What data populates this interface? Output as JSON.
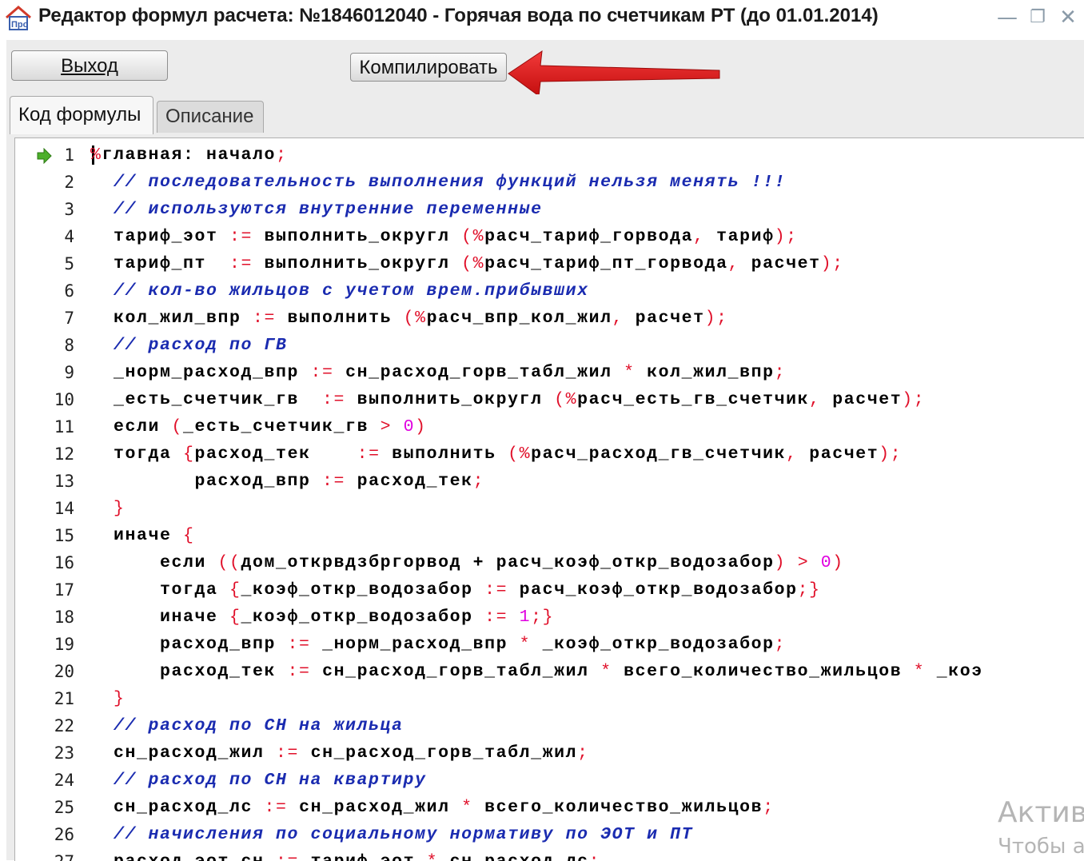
{
  "window": {
    "title": "Редактор формул расчета:  №1846012040 - Горячая вода по счетчикам РТ (до 01.01.2014)",
    "app_icon": "pro-logo-house-icon",
    "controls": [
      "minimize-icon",
      "maximize-icon",
      "close-icon"
    ]
  },
  "toolbar": {
    "exit_label": "Выход",
    "compile_label": "Компилировать",
    "annotation": "red-arrow-pointing-at-compile"
  },
  "tabs": [
    {
      "label": "Код формулы",
      "active": true
    },
    {
      "label": "Описание",
      "active": false
    }
  ],
  "editor": {
    "current_line": 1,
    "line_numbers": [
      "1",
      "2",
      "3",
      "4",
      "5",
      "6",
      "7",
      "8",
      "9",
      "10",
      "11",
      "12",
      "13",
      "14",
      "15",
      "16",
      "17",
      "18",
      "19",
      "20",
      "21",
      "22",
      "23",
      "24",
      "25",
      "26",
      "27"
    ],
    "lines": [
      [
        {
          "t": "%",
          "c": "op"
        },
        {
          "t": "главная: начало",
          "c": "k"
        },
        {
          "t": ";",
          "c": "op"
        }
      ],
      [
        {
          "t": "  // последовательность выполнения функций нельзя менять !!!",
          "c": "cm"
        }
      ],
      [
        {
          "t": "  // используются внутренние переменные",
          "c": "cm"
        }
      ],
      [
        {
          "t": "  тариф_эот ",
          "c": "k"
        },
        {
          "t": ":=",
          "c": "op"
        },
        {
          "t": " выполнить_округл ",
          "c": "k"
        },
        {
          "t": "(%",
          "c": "op"
        },
        {
          "t": "расч_тариф_горвода",
          "c": "k"
        },
        {
          "t": ",",
          "c": "op"
        },
        {
          "t": " тариф",
          "c": "k"
        },
        {
          "t": ");",
          "c": "op"
        }
      ],
      [
        {
          "t": "  тариф_пт  ",
          "c": "k"
        },
        {
          "t": ":=",
          "c": "op"
        },
        {
          "t": " выполнить_округл ",
          "c": "k"
        },
        {
          "t": "(%",
          "c": "op"
        },
        {
          "t": "расч_тариф_пт_горвода",
          "c": "k"
        },
        {
          "t": ",",
          "c": "op"
        },
        {
          "t": " расчет",
          "c": "k"
        },
        {
          "t": ");",
          "c": "op"
        }
      ],
      [
        {
          "t": "  // кол-во жильцов с учетом врем.прибывших",
          "c": "cm"
        }
      ],
      [
        {
          "t": "  кол_жил_впр ",
          "c": "k"
        },
        {
          "t": ":=",
          "c": "op"
        },
        {
          "t": " выполнить ",
          "c": "k"
        },
        {
          "t": "(%",
          "c": "op"
        },
        {
          "t": "расч_впр_кол_жил",
          "c": "k"
        },
        {
          "t": ",",
          "c": "op"
        },
        {
          "t": " расчет",
          "c": "k"
        },
        {
          "t": ");",
          "c": "op"
        }
      ],
      [
        {
          "t": "  // расход по ГВ",
          "c": "cm"
        }
      ],
      [
        {
          "t": "  _норм_расход_впр ",
          "c": "k"
        },
        {
          "t": ":=",
          "c": "op"
        },
        {
          "t": " сн_расход_горв_табл_жил ",
          "c": "k"
        },
        {
          "t": "*",
          "c": "op"
        },
        {
          "t": " кол_жил_впр",
          "c": "k"
        },
        {
          "t": ";",
          "c": "op"
        }
      ],
      [
        {
          "t": "  _есть_счетчик_гв  ",
          "c": "k"
        },
        {
          "t": ":=",
          "c": "op"
        },
        {
          "t": " выполнить_округл ",
          "c": "k"
        },
        {
          "t": "(%",
          "c": "op"
        },
        {
          "t": "расч_есть_гв_счетчик",
          "c": "k"
        },
        {
          "t": ",",
          "c": "op"
        },
        {
          "t": " расчет",
          "c": "k"
        },
        {
          "t": ");",
          "c": "op"
        }
      ],
      [
        {
          "t": "  если ",
          "c": "k"
        },
        {
          "t": "(",
          "c": "op"
        },
        {
          "t": "_есть_счетчик_гв ",
          "c": "k"
        },
        {
          "t": ">",
          "c": "op"
        },
        {
          "t": " ",
          "c": "k"
        },
        {
          "t": "0",
          "c": "nm"
        },
        {
          "t": ")",
          "c": "op"
        }
      ],
      [
        {
          "t": "  тогда ",
          "c": "k"
        },
        {
          "t": "{",
          "c": "op"
        },
        {
          "t": "расход_тек    ",
          "c": "k"
        },
        {
          "t": ":=",
          "c": "op"
        },
        {
          "t": " выполнить ",
          "c": "k"
        },
        {
          "t": "(%",
          "c": "op"
        },
        {
          "t": "расч_расход_гв_счетчик",
          "c": "k"
        },
        {
          "t": ",",
          "c": "op"
        },
        {
          "t": " расчет",
          "c": "k"
        },
        {
          "t": ");",
          "c": "op"
        }
      ],
      [
        {
          "t": "         расход_впр ",
          "c": "k"
        },
        {
          "t": ":=",
          "c": "op"
        },
        {
          "t": " расход_тек",
          "c": "k"
        },
        {
          "t": ";",
          "c": "op"
        }
      ],
      [
        {
          "t": "  }",
          "c": "op"
        }
      ],
      [
        {
          "t": "  иначе ",
          "c": "k"
        },
        {
          "t": "{",
          "c": "op"
        }
      ],
      [
        {
          "t": "      если ",
          "c": "k"
        },
        {
          "t": "((",
          "c": "op"
        },
        {
          "t": "дом_открвдзбргорвод + расч_коэф_откр_водозабор",
          "c": "k"
        },
        {
          "t": ")",
          "c": "op"
        },
        {
          "t": " ",
          "c": "k"
        },
        {
          "t": ">",
          "c": "op"
        },
        {
          "t": " ",
          "c": "k"
        },
        {
          "t": "0",
          "c": "nm"
        },
        {
          "t": ")",
          "c": "op"
        }
      ],
      [
        {
          "t": "      тогда ",
          "c": "k"
        },
        {
          "t": "{",
          "c": "op"
        },
        {
          "t": "_коэф_откр_водозабор ",
          "c": "k"
        },
        {
          "t": ":=",
          "c": "op"
        },
        {
          "t": " расч_коэф_откр_водозабор",
          "c": "k"
        },
        {
          "t": ";}",
          "c": "op"
        }
      ],
      [
        {
          "t": "      иначе ",
          "c": "k"
        },
        {
          "t": "{",
          "c": "op"
        },
        {
          "t": "_коэф_откр_водозабор ",
          "c": "k"
        },
        {
          "t": ":=",
          "c": "op"
        },
        {
          "t": " ",
          "c": "k"
        },
        {
          "t": "1",
          "c": "nm"
        },
        {
          "t": ";}",
          "c": "op"
        }
      ],
      [
        {
          "t": "      расход_впр ",
          "c": "k"
        },
        {
          "t": ":=",
          "c": "op"
        },
        {
          "t": " _норм_расход_впр ",
          "c": "k"
        },
        {
          "t": "*",
          "c": "op"
        },
        {
          "t": " _коэф_откр_водозабор",
          "c": "k"
        },
        {
          "t": ";",
          "c": "op"
        }
      ],
      [
        {
          "t": "      расход_тек ",
          "c": "k"
        },
        {
          "t": ":=",
          "c": "op"
        },
        {
          "t": " сн_расход_горв_табл_жил ",
          "c": "k"
        },
        {
          "t": "*",
          "c": "op"
        },
        {
          "t": " всего_количество_жильцов ",
          "c": "k"
        },
        {
          "t": "*",
          "c": "op"
        },
        {
          "t": " _коэ",
          "c": "k"
        }
      ],
      [
        {
          "t": "  }",
          "c": "op"
        }
      ],
      [
        {
          "t": "  // расход по СН на жильца",
          "c": "cm"
        }
      ],
      [
        {
          "t": "  сн_расход_жил ",
          "c": "k"
        },
        {
          "t": ":=",
          "c": "op"
        },
        {
          "t": " сн_расход_горв_табл_жил",
          "c": "k"
        },
        {
          "t": ";",
          "c": "op"
        }
      ],
      [
        {
          "t": "  // расход по СН на квартиру",
          "c": "cm"
        }
      ],
      [
        {
          "t": "  сн_расход_лс ",
          "c": "k"
        },
        {
          "t": ":=",
          "c": "op"
        },
        {
          "t": " сн_расход_жил ",
          "c": "k"
        },
        {
          "t": "*",
          "c": "op"
        },
        {
          "t": " всего_количество_жильцов",
          "c": "k"
        },
        {
          "t": ";",
          "c": "op"
        }
      ],
      [
        {
          "t": "  // начисления по социальному нормативу по ЭОТ и ПТ",
          "c": "cm"
        }
      ],
      [
        {
          "t": "  расход_эот_сн ",
          "c": "k"
        },
        {
          "t": ":=",
          "c": "op"
        },
        {
          "t": " тариф_эот ",
          "c": "k"
        },
        {
          "t": "*",
          "c": "op"
        },
        {
          "t": " сн_расход_лс",
          "c": "k"
        },
        {
          "t": ";",
          "c": "op"
        }
      ]
    ]
  },
  "watermark": {
    "line1": "Актив",
    "line2": "Чтобы а"
  }
}
